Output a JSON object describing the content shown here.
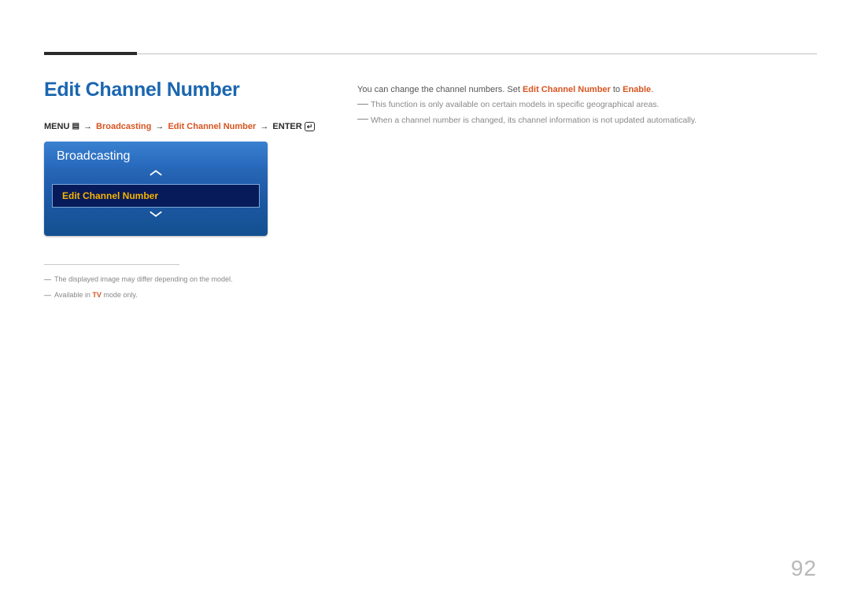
{
  "page": {
    "title": "Edit Channel Number",
    "number": "92"
  },
  "breadcrumb": {
    "menu_label": "MENU",
    "arrow": "→",
    "seg1": "Broadcasting",
    "seg2": "Edit Channel Number",
    "enter_label": "ENTER"
  },
  "menu_widget": {
    "header": "Broadcasting",
    "selected": "Edit Channel Number"
  },
  "footnotes": {
    "fn1": "The displayed image may differ depending on the model.",
    "fn2_pre": "Available in ",
    "fn2_tv": "TV",
    "fn2_post": " mode only."
  },
  "body": {
    "line1_pre": "You can change the channel numbers. Set ",
    "line1_b1": "Edit Channel Number",
    "line1_mid": " to ",
    "line1_b2": "Enable",
    "line1_post": ".",
    "note1": "This function is only available on certain models in specific geographical areas.",
    "note2": "When a channel number is changed, its channel information is not updated automatically."
  }
}
